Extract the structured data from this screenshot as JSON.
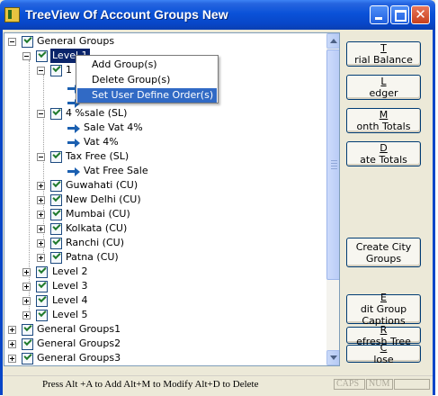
{
  "window": {
    "title": "TreeView Of Account Groups New"
  },
  "tree": {
    "nodes": [
      {
        "label": "General Groups",
        "icon": "checkbox-icon"
      },
      {
        "label": "Level 1",
        "icon": "checkbox-icon",
        "selected": true
      },
      {
        "label": "1",
        "icon": "checkbox-icon"
      },
      {
        "label": "4 %sale (SL)",
        "icon": "checkbox-icon"
      },
      {
        "label": "Sale Vat 4%",
        "icon": "arrow-icon"
      },
      {
        "label": "Vat 4%",
        "icon": "arrow-icon"
      },
      {
        "label": "Tax Free (SL)",
        "icon": "checkbox-icon"
      },
      {
        "label": "Vat Free Sale",
        "icon": "arrow-icon"
      },
      {
        "label": "Guwahati (CU)",
        "icon": "checkbox-icon"
      },
      {
        "label": "New Delhi (CU)",
        "icon": "checkbox-icon"
      },
      {
        "label": "Mumbai (CU)",
        "icon": "checkbox-icon"
      },
      {
        "label": "Kolkata (CU)",
        "icon": "checkbox-icon"
      },
      {
        "label": "Ranchi (CU)",
        "icon": "checkbox-icon"
      },
      {
        "label": "Patna (CU)",
        "icon": "checkbox-icon"
      },
      {
        "label": "Level 2",
        "icon": "checkbox-icon"
      },
      {
        "label": "Level 3",
        "icon": "checkbox-icon"
      },
      {
        "label": "Level 4",
        "icon": "checkbox-icon"
      },
      {
        "label": "Level 5",
        "icon": "checkbox-icon"
      },
      {
        "label": "General Groups1",
        "icon": "checkbox-icon"
      },
      {
        "label": "General Groups2",
        "icon": "checkbox-icon"
      },
      {
        "label": "General Groups3",
        "icon": "checkbox-icon"
      }
    ]
  },
  "context_menu": {
    "items": [
      {
        "label": "Add Group(s)"
      },
      {
        "label": "Delete Group(s)"
      },
      {
        "label": "Set User Define Order(s)",
        "highlighted": true
      }
    ]
  },
  "buttons": {
    "trial_balance": {
      "pre": "",
      "key": "T",
      "post": "rial Balance"
    },
    "ledger": {
      "pre": "",
      "key": "L",
      "post": "edger"
    },
    "month_totals": {
      "pre": "",
      "key": "M",
      "post": "onth Totals"
    },
    "date_totals": {
      "pre": "",
      "key": "D",
      "post": "ate Totals"
    },
    "create_city_groups": {
      "line1": "Create City",
      "line2": "Groups"
    },
    "edit_group_captions": {
      "pre": "",
      "key": "E",
      "post": "dit Group",
      "line2": "Captions"
    },
    "refresh_tree": {
      "pre": "",
      "key": "R",
      "post": "efresh Tree"
    },
    "close": {
      "pre": "",
      "key": "C",
      "post": "lose"
    }
  },
  "status_bar": {
    "hint": "Press  Alt +A to Add   Alt+M to Modify   Alt+D to Delete",
    "caps": "CAPS",
    "num": "NUM"
  },
  "colors": {
    "titlebar": "#0a52d8",
    "selection": "#0a246a",
    "menu_highlight": "#316ac5",
    "close_button": "#c8401c"
  }
}
